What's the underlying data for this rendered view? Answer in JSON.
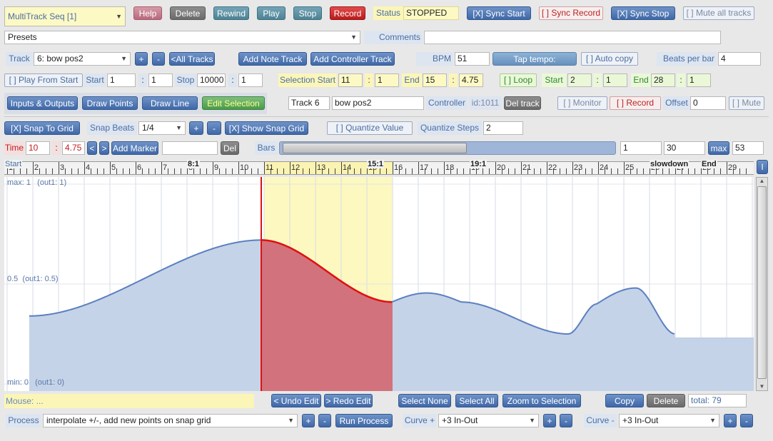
{
  "top": {
    "title": "MultiTrack Seq [1]",
    "help": "Help",
    "delete": "Delete",
    "rewind": "Rewind",
    "play": "Play",
    "stop": "Stop",
    "record": "Record",
    "status_label": "Status",
    "status_value": "STOPPED",
    "sync_start": "[X] Sync Start",
    "sync_record": "[ ] Sync Record",
    "sync_stop": "[X] Sync Stop",
    "mute_all": "[ ] Mute all tracks"
  },
  "presets": {
    "value": "Presets",
    "comments_label": "Comments",
    "comments_value": ""
  },
  "track": {
    "label": "Track",
    "value": "6: bow pos2",
    "plus": "+",
    "minus": "-",
    "all": "<All Tracks",
    "add_note": "Add Note Track",
    "add_ctrl": "Add Controller Track",
    "bpm_label": "BPM",
    "bpm": "51",
    "tap": "Tap tempo:",
    "auto_copy": "[ ] Auto copy",
    "bpb_label": "Beats per bar",
    "bpb": "4"
  },
  "play_row": {
    "play_from_start": "[ ] Play From Start",
    "start_label": "Start",
    "start_bar": "1",
    "start_beat": "1",
    "stop_label": "Stop",
    "stop_bar": "10000",
    "stop_beat": "1",
    "sel_start_label": "Selection Start",
    "sel_start_bar": "11",
    "sel_start_beat": "1",
    "sel_end_label": "End",
    "sel_end_bar": "15",
    "sel_end_beat": "4.75",
    "loop": "[ ] Loop",
    "loop_start_label": "Start",
    "loop_start_bar": "2",
    "loop_start_beat": "1",
    "loop_end_label": "End",
    "loop_end_bar": "28",
    "loop_end_beat": "1"
  },
  "tools": {
    "io": "Inputs & Outputs",
    "draw_points": "Draw Points",
    "draw_line": "Draw Line",
    "edit_selection": "Edit Selection",
    "track_name": "Track 6",
    "track_desc": "bow pos2",
    "controller_label": "Controller",
    "controller_id": "id:1011",
    "del_track": "Del track",
    "monitor": "[ ] Monitor",
    "record": "[ ] Record",
    "offset_label": "Offset",
    "offset": "0",
    "mute": "[ ] Mute"
  },
  "snap": {
    "snap_to_grid": "[X] Snap To Grid",
    "snap_beats_label": "Snap Beats",
    "snap_beats": "1/4",
    "plus": "+",
    "minus": "-",
    "show_grid": "[X] Show Snap Grid",
    "quantize_value": "[ ] Quantize Value",
    "quantize_steps_label": "Quantize Steps",
    "quantize_steps": "2"
  },
  "time": {
    "label": "Time",
    "bar": "10",
    "beat": "4.75",
    "prev": "<",
    "next": ">",
    "add_marker": "Add Marker",
    "marker_name": "",
    "del": "Del",
    "bars_label": "Bars",
    "bars_from": "1",
    "bars_to": "30",
    "max_label": "max",
    "max_value": "53"
  },
  "ruler": {
    "numbers": [
      "1",
      "2",
      "3",
      "4",
      "5",
      "6",
      "7",
      "8",
      "9",
      "10",
      "11",
      "12",
      "13",
      "14",
      "15",
      "16",
      "17",
      "18",
      "19",
      "20",
      "21",
      "22",
      "23",
      "24",
      "25",
      "26",
      "27",
      "28",
      "29"
    ],
    "markers": [
      "Start",
      "8:1",
      "15:1",
      "19:1",
      "slowdown",
      "End"
    ],
    "side_button": "I"
  },
  "graph": {
    "max_label": "max: 1   (out1: 1)",
    "mid_label": "0.5  (out1: 0.5)",
    "min_label": "min: 0   (out1: 0)",
    "fill_color": "#c5d3e8",
    "line_color": "#5b7fc0",
    "sel_color": "#e01010",
    "sel_bg": "#fdf8c0"
  },
  "bottom": {
    "mouse": "Mouse: ...",
    "undo": "< Undo Edit",
    "redo": "> Redo Edit",
    "select_none": "Select None",
    "select_all": "Select All",
    "zoom": "Zoom to Selection",
    "copy": "Copy",
    "delete": "Delete",
    "total": "total: 79"
  },
  "process": {
    "label": "Process",
    "value": "interpolate +/-, add new points on snap grid",
    "plus": "+",
    "minus": "-",
    "run": "Run Process",
    "curve_plus_label": "Curve +",
    "curve_plus": "+3  In-Out",
    "curve_minus_label": "Curve -",
    "curve_minus": "+3  In-Out"
  }
}
